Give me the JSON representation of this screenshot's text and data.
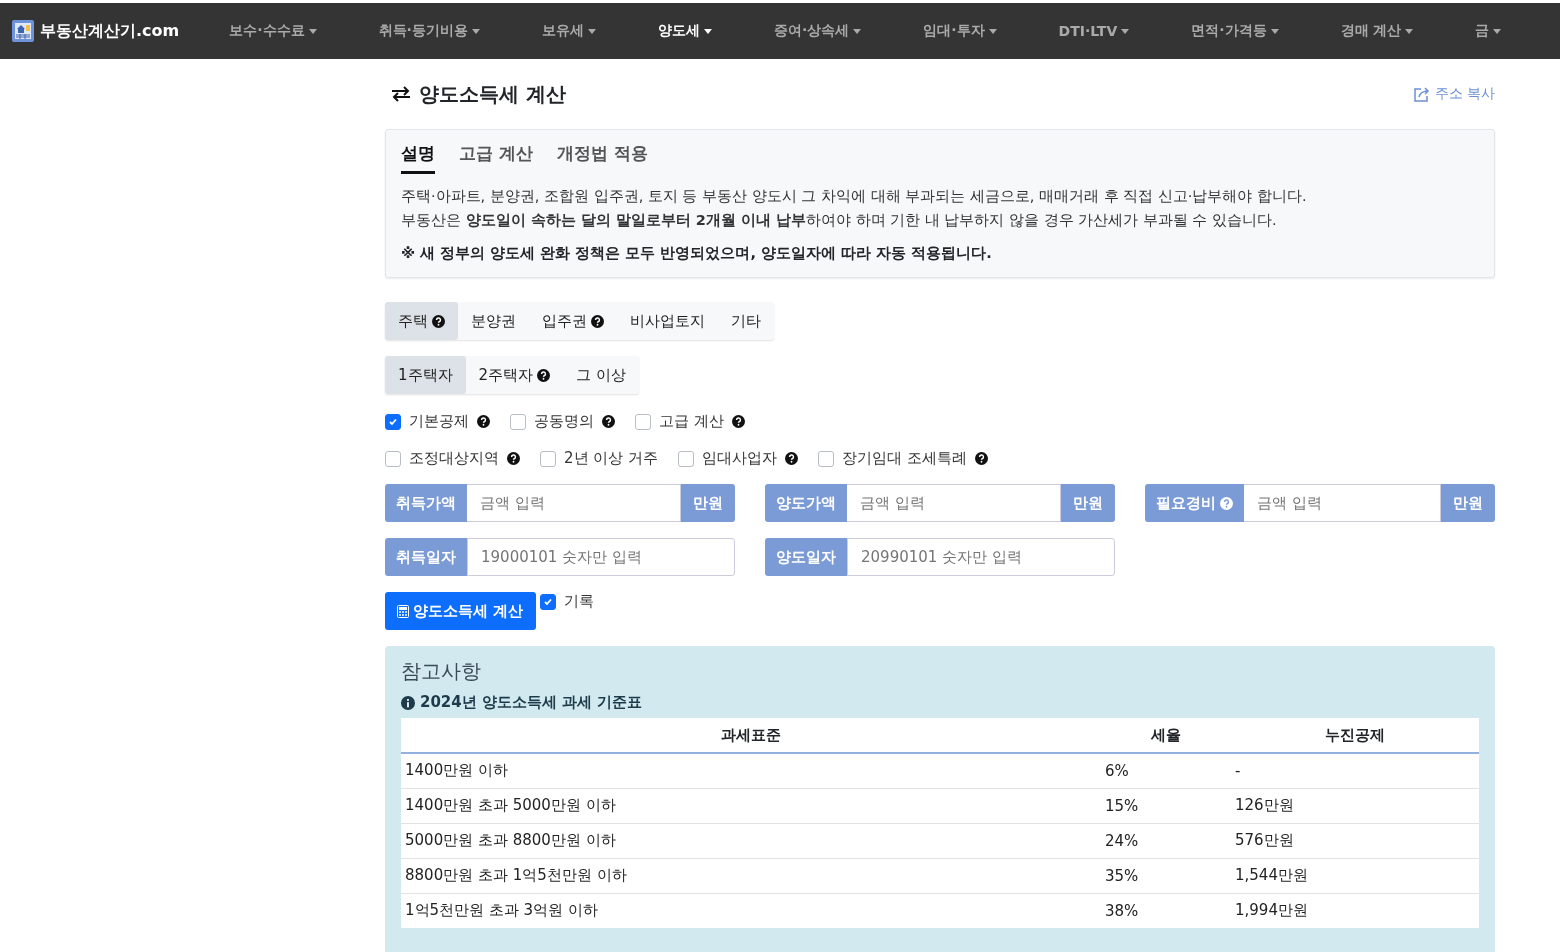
{
  "nav": {
    "brand": "부동산계산기.com",
    "items": [
      {
        "label": "보수·수수료",
        "selected": false
      },
      {
        "label": "취득·등기비용",
        "selected": false
      },
      {
        "label": "보유세",
        "selected": false
      },
      {
        "label": "양도세",
        "selected": true
      },
      {
        "label": "증여·상속세",
        "selected": false
      },
      {
        "label": "임대·투자",
        "selected": false
      },
      {
        "label": "DTI·LTV",
        "selected": false
      },
      {
        "label": "면적·가격등",
        "selected": false
      },
      {
        "label": "경매 계산",
        "selected": false
      },
      {
        "label": "금",
        "selected": false
      }
    ]
  },
  "title": "양도소득세 계산",
  "copy_link": "주소 복사",
  "info": {
    "tabs": [
      {
        "label": "설명",
        "selected": true
      },
      {
        "label": "고급 계산",
        "selected": false
      },
      {
        "label": "개정법 적용",
        "selected": false
      }
    ],
    "paragraphs": [
      "주택·아파트, 분양권, 조합원 입주권, 토지 등 부동산 양도시 그 차익에 대해 부과되는 세금으로, 매매거래 후 직접 신고·납부해야 합니다.",
      "부동산은 **양도일이 속하는 달의 말일로부터 2개월 이내 납부**하여야 하며 기한 내 납부하지 않을 경우 가산세가 부과될 수 있습니다."
    ],
    "notice": "※ 새 정부의 양도세 완화 정책은 모두 반영되었으며, 양도일자에 따라 자동 적용됩니다."
  },
  "property_types": [
    {
      "label": "주택",
      "help": true,
      "selected": true
    },
    {
      "label": "분양권",
      "help": false,
      "selected": false
    },
    {
      "label": "입주권",
      "help": true,
      "selected": false
    },
    {
      "label": "비사업토지",
      "help": false,
      "selected": false
    },
    {
      "label": "기타",
      "help": false,
      "selected": false
    }
  ],
  "house_counts": [
    {
      "label": "1주택자",
      "help": false,
      "selected": true
    },
    {
      "label": "2주택자",
      "help": true,
      "selected": false
    },
    {
      "label": "그 이상",
      "help": false,
      "selected": false
    }
  ],
  "option_rows": [
    [
      {
        "label": "기본공제",
        "help": true,
        "checked": true
      },
      {
        "label": "공동명의",
        "help": true,
        "checked": false
      },
      {
        "label": "고급 계산",
        "help": true,
        "checked": false
      }
    ],
    [
      {
        "label": "조정대상지역",
        "help": true,
        "checked": false
      },
      {
        "label": "2년 이상 거주",
        "help": false,
        "checked": false
      },
      {
        "label": "임대사업자",
        "help": true,
        "checked": false
      },
      {
        "label": "장기임대 조세특례",
        "help": true,
        "checked": false
      }
    ]
  ],
  "field_rows": [
    [
      {
        "label": "취득가액",
        "help": false,
        "placeholder": "금액 입력",
        "unit": "만원"
      },
      {
        "label": "양도가액",
        "help": false,
        "placeholder": "금액 입력",
        "unit": "만원"
      },
      {
        "label": "필요경비",
        "help": true,
        "placeholder": "금액 입력",
        "unit": "만원"
      }
    ],
    [
      {
        "label": "취득일자",
        "help": false,
        "placeholder": "19000101 숫자만 입력"
      },
      {
        "label": "양도일자",
        "help": false,
        "placeholder": "20990101 숫자만 입력"
      }
    ]
  ],
  "calculate_button": "양도소득세 계산",
  "record": {
    "label": "기록",
    "checked": true
  },
  "reference": {
    "title": "참고사항",
    "subtitle": "2024년 양도소득세 과세 기준표",
    "columns": [
      "과세표준",
      "세율",
      "누진공제"
    ],
    "rows": [
      [
        "1400만원 이하",
        "6%",
        "-"
      ],
      [
        "1400만원 초과 5000만원 이하",
        "15%",
        "126만원"
      ],
      [
        "5000만원 초과 8800만원 이하",
        "24%",
        "576만원"
      ],
      [
        "8800만원 초과 1억5천만원 이하",
        "35%",
        "1,544만원"
      ],
      [
        "1억5천만원 초과 3억원 이하",
        "38%",
        "1,994만원"
      ]
    ]
  }
}
